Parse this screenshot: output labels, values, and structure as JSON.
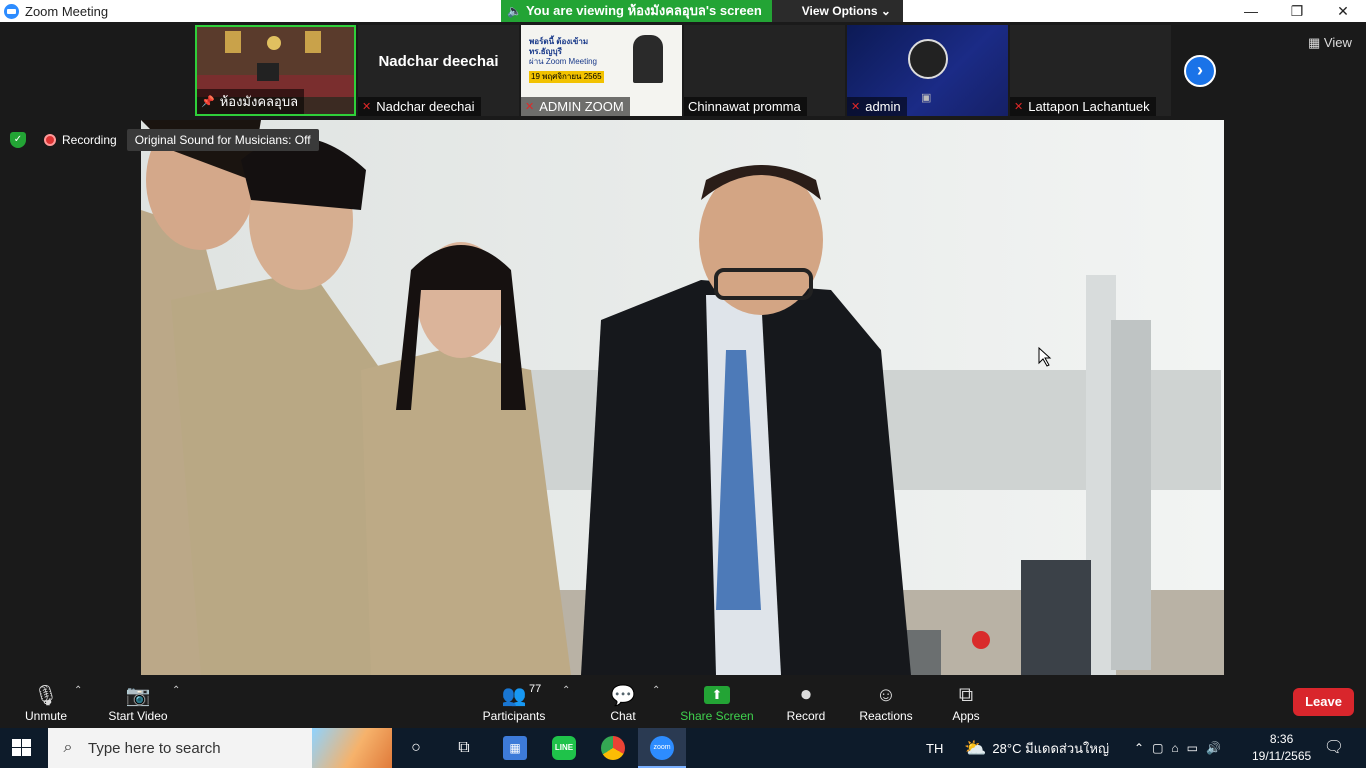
{
  "window": {
    "title": "Zoom Meeting",
    "controls": [
      "—",
      "❐",
      "✕"
    ]
  },
  "banner": {
    "viewing": "You are viewing ห้องมังคลอุบล's screen",
    "options": "View Options ⌄"
  },
  "gallery": {
    "tiles": [
      {
        "name": "ห้องมังคลอุบล",
        "big_name": ""
      },
      {
        "name": "Nadchar deechai",
        "big_name": "Nadchar deechai"
      },
      {
        "name": "ADMIN ZOOM",
        "big_name": ""
      },
      {
        "name": "Chinnawat promma",
        "big_name": ""
      },
      {
        "name": "admin",
        "big_name": ""
      },
      {
        "name": "Lattapon Lachantuek",
        "big_name": ""
      }
    ],
    "poster_text": {
      "line1": "พอร์ตนี้ ต้องเข้ามทร.ธัญบุรี",
      "line2": "ผ่าน Zoom Meeting",
      "date": "19 พฤศจิกายน 2565"
    },
    "next_arrow": "›",
    "view_label": "View"
  },
  "status": {
    "recording": "Recording",
    "original_sound": "Original Sound for Musicians: Off"
  },
  "toolbar": {
    "unmute": "Unmute",
    "start_video": "Start Video",
    "participants": "Participants",
    "participant_count": "77",
    "chat": "Chat",
    "share_screen": "Share Screen",
    "record": "Record",
    "reactions": "Reactions",
    "apps": "Apps",
    "leave": "Leave"
  },
  "taskbar": {
    "search_placeholder": "Type here to search",
    "lang": "TH",
    "weather": "28°C มีแดดส่วนใหญ่",
    "time": "8:36",
    "date": "19/11/2565"
  }
}
